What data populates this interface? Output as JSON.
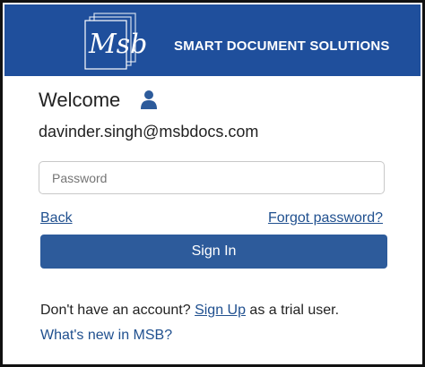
{
  "header": {
    "logo_text": "Msb",
    "brand": "SMART DOCUMENT SOLUTIONS",
    "background_color": "#1f4f9c"
  },
  "welcome": {
    "title": "Welcome",
    "icon": "user-icon",
    "email": "davinder.singh@msbdocs.com"
  },
  "form": {
    "password_placeholder": "Password",
    "back_label": "Back",
    "forgot_label": "Forgot password?",
    "signin_label": "Sign In",
    "signin_color": "#2d5b9b"
  },
  "footer": {
    "signup_prefix": "Don't have an account? ",
    "signup_link": "Sign Up",
    "signup_suffix": " as a trial user.",
    "whats_new": "What's new in MSB?",
    "link_color": "#20508f"
  }
}
